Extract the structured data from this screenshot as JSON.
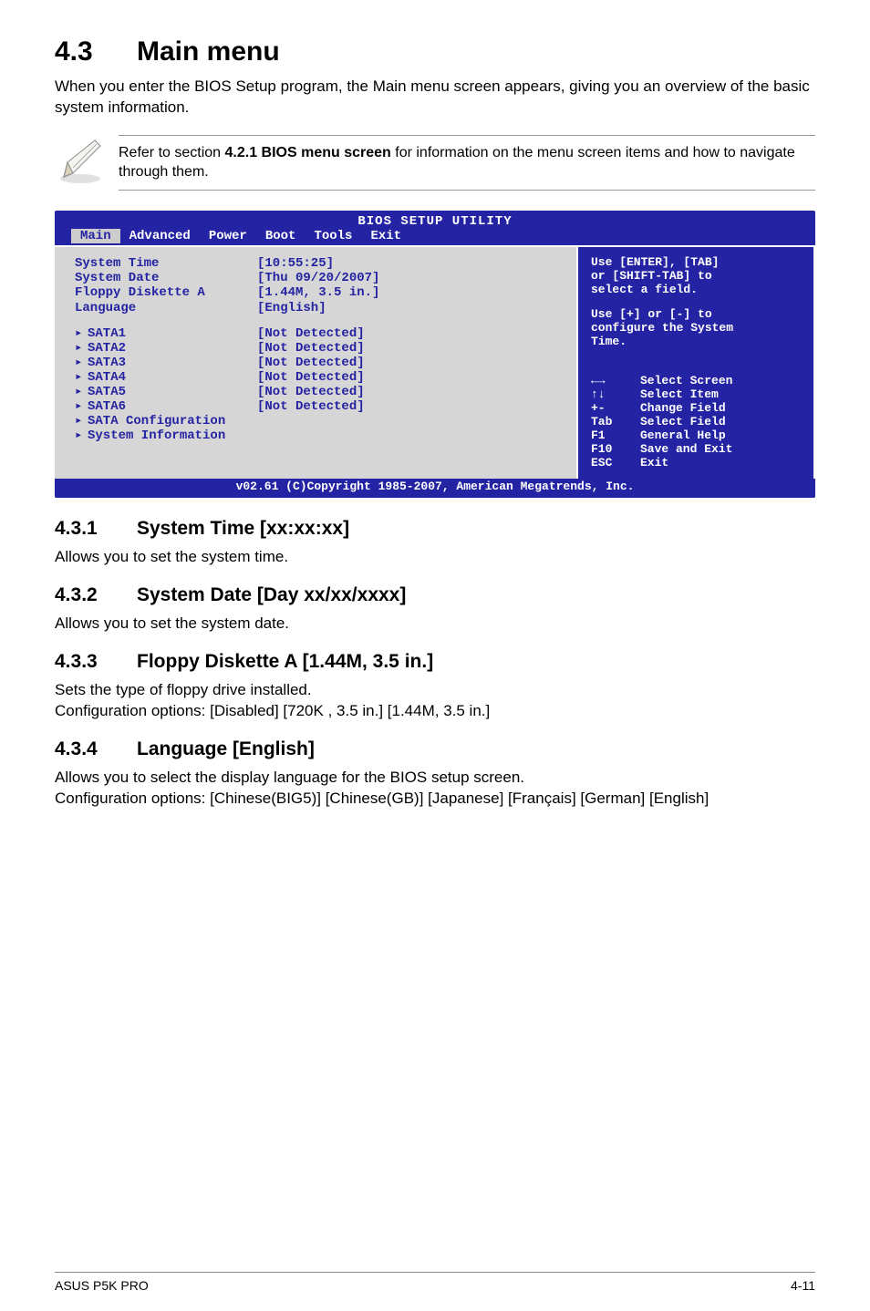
{
  "section": {
    "num": "4.3",
    "title": "Main menu"
  },
  "intro": "When you enter the BIOS Setup program, the Main menu screen appears, giving you an overview of the basic system information.",
  "note": {
    "prefix": "Refer to section ",
    "bold": "4.2.1  BIOS menu screen",
    "suffix": " for information on the menu screen items and how to navigate through them."
  },
  "bios": {
    "title": "BIOS SETUP UTILITY",
    "menu": [
      "Main",
      "Advanced",
      "Power",
      "Boot",
      "Tools",
      "Exit"
    ],
    "active_menu": "Main",
    "rows_top": [
      {
        "label": "System Time",
        "value": "[10:55:25]"
      },
      {
        "label": "System Date",
        "value": "[Thu 09/20/2007]"
      },
      {
        "label": "Floppy Diskette A",
        "value": "[1.44M, 3.5 in.]"
      },
      {
        "label": "Language",
        "value": "[English]"
      }
    ],
    "rows_sata": [
      {
        "label": "SATA1",
        "value": "[Not Detected]"
      },
      {
        "label": "SATA2",
        "value": "[Not Detected]"
      },
      {
        "label": "SATA3",
        "value": "[Not Detected]"
      },
      {
        "label": "SATA4",
        "value": "[Not Detected]"
      },
      {
        "label": "SATA5",
        "value": "[Not Detected]"
      },
      {
        "label": "SATA6",
        "value": "[Not Detected]"
      }
    ],
    "rows_sub": [
      {
        "label": "SATA Configuration"
      },
      {
        "label": "System Information"
      }
    ],
    "help_top": [
      "Use [ENTER], [TAB]",
      "or [SHIFT-TAB] to",
      "select a field."
    ],
    "help_mid": [
      "Use [+] or [-] to",
      "configure the System",
      "Time."
    ],
    "keys": [
      {
        "k": "←→",
        "d": "Select Screen"
      },
      {
        "k": "↑↓",
        "d": "Select Item"
      },
      {
        "k": "+-",
        "d": "Change Field"
      },
      {
        "k": "Tab",
        "d": "Select Field"
      },
      {
        "k": "F1",
        "d": "General Help"
      },
      {
        "k": "F10",
        "d": "Save and Exit"
      },
      {
        "k": "ESC",
        "d": "Exit"
      }
    ],
    "footer": "v02.61 (C)Copyright 1985-2007, American Megatrends, Inc."
  },
  "subs": [
    {
      "num": "4.3.1",
      "title": "System Time [xx:xx:xx]",
      "body": [
        "Allows you to set the system time."
      ]
    },
    {
      "num": "4.3.2",
      "title": "System Date [Day xx/xx/xxxx]",
      "body": [
        "Allows you to set the system date."
      ]
    },
    {
      "num": "4.3.3",
      "title": "Floppy Diskette A [1.44M, 3.5 in.]",
      "body": [
        "Sets the type of floppy drive installed.",
        "Configuration options: [Disabled] [720K , 3.5 in.] [1.44M, 3.5 in.]"
      ]
    },
    {
      "num": "4.3.4",
      "title": "Language [English]",
      "body": [
        "Allows you to select the display language for the BIOS setup screen.",
        "Configuration options: [Chinese(BIG5)] [Chinese(GB)] [Japanese] [Français] [German] [English]"
      ]
    }
  ],
  "footer": {
    "left": "ASUS P5K PRO",
    "right": "4-11"
  }
}
